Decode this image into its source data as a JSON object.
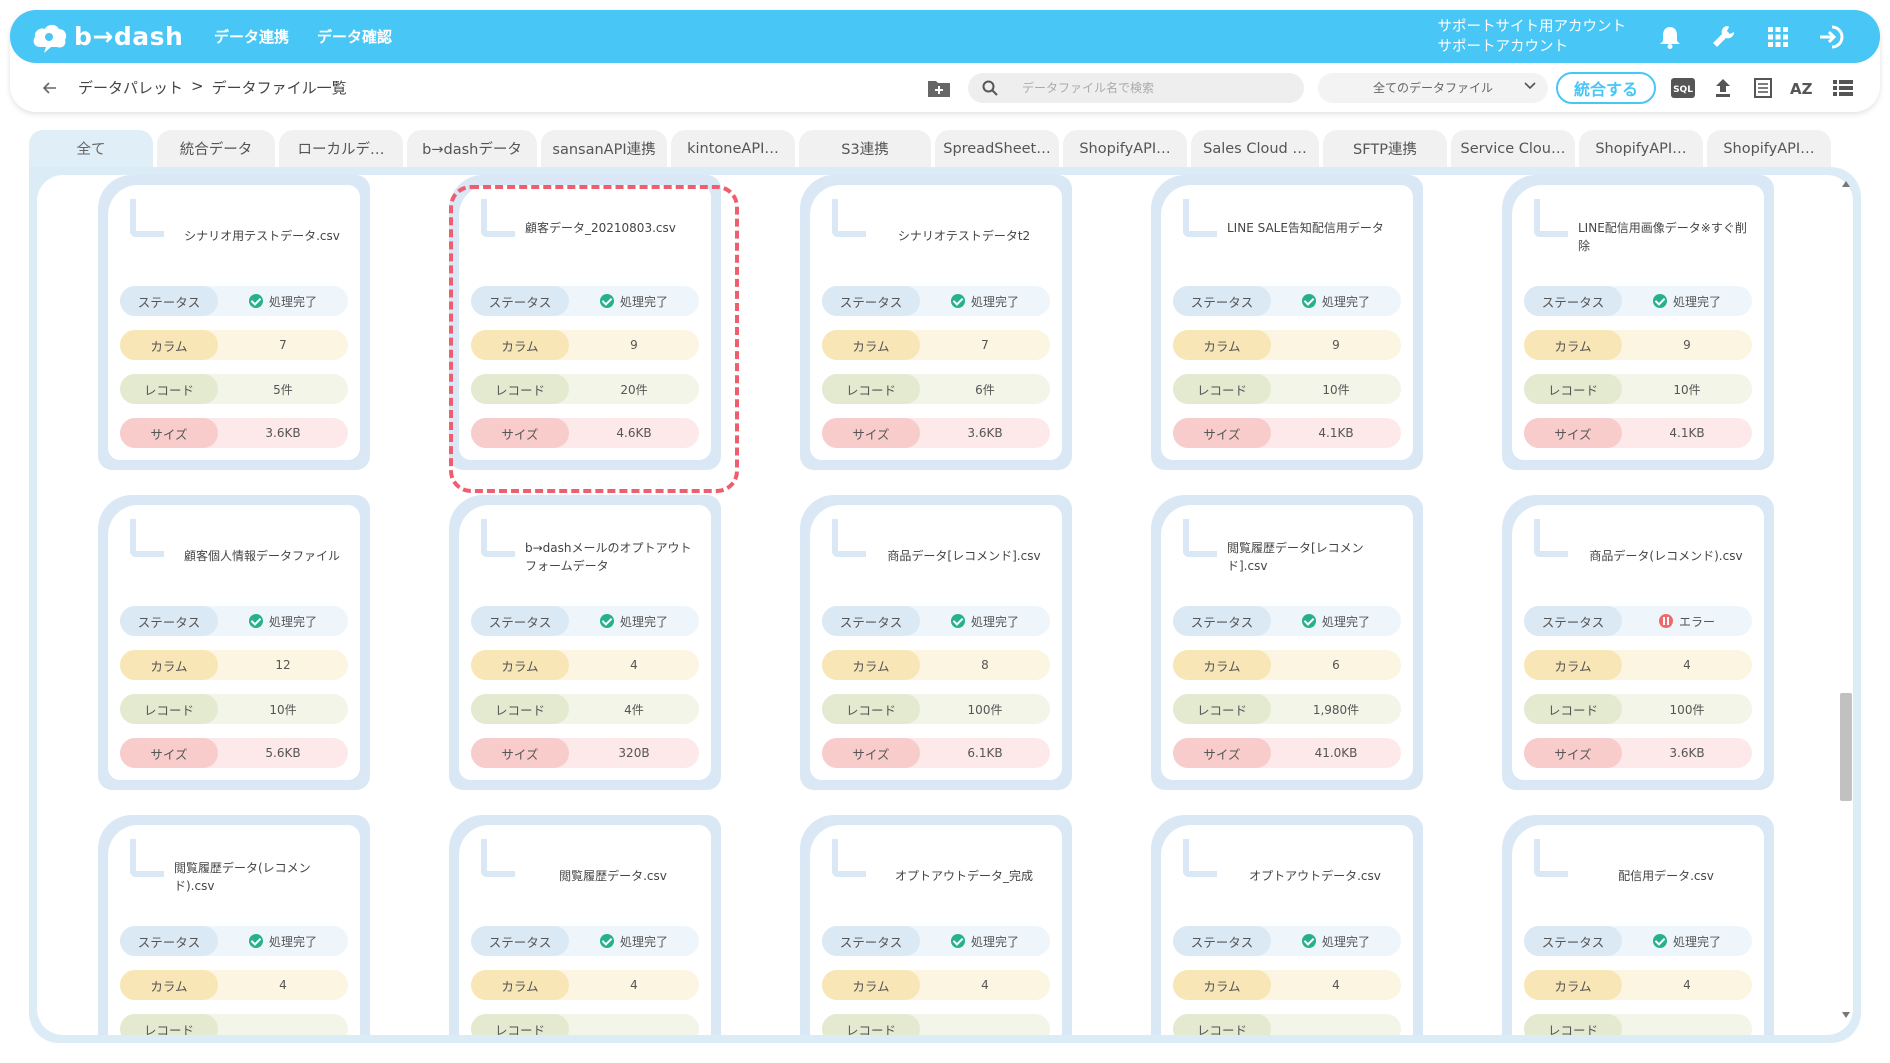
{
  "header": {
    "logo_text": "b→dash",
    "nav": [
      "データ連携",
      "データ確認"
    ],
    "account_line1": "サポートサイト用アカウント",
    "account_line2": "サポートアカウント",
    "icons": [
      "bell-icon",
      "wrench-icon",
      "grid-icon",
      "logout-icon"
    ]
  },
  "toolbar": {
    "breadcrumb": [
      "データパレット",
      ">",
      "データファイル一覧"
    ],
    "search_placeholder": "データファイル名で検索",
    "file_filter": "全てのデータファイル",
    "merge_label": "統合する",
    "sql_label": "SQL",
    "az_label": "AZ"
  },
  "tabs": [
    {
      "label": "全て",
      "w": 124
    },
    {
      "label": "統合データ",
      "w": 118
    },
    {
      "label": "ローカルデ…",
      "w": 124
    },
    {
      "label": "b→dashデータ",
      "w": 130
    },
    {
      "label": "sansanAPI連携",
      "w": 126
    },
    {
      "label": "kintoneAPI…",
      "w": 124
    },
    {
      "label": "S3連携",
      "w": 132
    },
    {
      "label": "SpreadSheet…",
      "w": 124
    },
    {
      "label": "ShopifyAPI…",
      "w": 124
    },
    {
      "label": "Sales Cloud …",
      "w": 128
    },
    {
      "label": "SFTP連携",
      "w": 124
    },
    {
      "label": "Service Clou…",
      "w": 124
    },
    {
      "label": "ShopifyAPI…",
      "w": 124
    },
    {
      "label": "ShopifyAPI…",
      "w": 124
    }
  ],
  "labels": {
    "status": "ステータス",
    "column": "カラム",
    "record": "レコード",
    "size": "サイズ"
  },
  "cards": [
    {
      "title": "シナリオ用テストデータ.csv",
      "status": "処理完了",
      "status_type": "ok",
      "columns": "7",
      "records": "5件",
      "size": "3.6KB"
    },
    {
      "title": "顧客データ_20210803.csv",
      "status": "処理完了",
      "status_type": "ok",
      "columns": "9",
      "records": "20件",
      "size": "4.6KB"
    },
    {
      "title": "シナリオテストデータt2",
      "status": "処理完了",
      "status_type": "ok",
      "columns": "7",
      "records": "6件",
      "size": "3.6KB"
    },
    {
      "title": "LINE SALE告知配信用データ",
      "status": "処理完了",
      "status_type": "ok",
      "columns": "9",
      "records": "10件",
      "size": "4.1KB"
    },
    {
      "title": "LINE配信用画像データ※すぐ削除",
      "status": "処理完了",
      "status_type": "ok",
      "columns": "9",
      "records": "10件",
      "size": "4.1KB"
    },
    {
      "title": "顧客個人情報データファイル",
      "status": "処理完了",
      "status_type": "ok",
      "columns": "12",
      "records": "10件",
      "size": "5.6KB"
    },
    {
      "title": "b→dashメールのオプトアウトフォームデータ",
      "status": "処理完了",
      "status_type": "ok",
      "columns": "4",
      "records": "4件",
      "size": "320B"
    },
    {
      "title": "商品データ[レコメンド].csv",
      "status": "処理完了",
      "status_type": "ok",
      "columns": "8",
      "records": "100件",
      "size": "6.1KB"
    },
    {
      "title": "閲覧履歴データ[レコメンド].csv",
      "status": "処理完了",
      "status_type": "ok",
      "columns": "6",
      "records": "1,980件",
      "size": "41.0KB"
    },
    {
      "title": "商品データ(レコメンド).csv",
      "status": "エラー",
      "status_type": "err",
      "columns": "4",
      "records": "100件",
      "size": "3.6KB"
    },
    {
      "title": "閲覧履歴データ(レコメンド).csv",
      "status": "処理完了",
      "status_type": "ok",
      "columns": "4",
      "records": "",
      "size": ""
    },
    {
      "title": "閲覧履歴データ.csv",
      "status": "処理完了",
      "status_type": "ok",
      "columns": "4",
      "records": "",
      "size": ""
    },
    {
      "title": "オプトアウトデータ_完成",
      "status": "処理完了",
      "status_type": "ok",
      "columns": "4",
      "records": "",
      "size": ""
    },
    {
      "title": "オプトアウトデータ.csv",
      "status": "処理完了",
      "status_type": "ok",
      "columns": "4",
      "records": "",
      "size": ""
    },
    {
      "title": "配信用データ.csv",
      "status": "処理完了",
      "status_type": "ok",
      "columns": "4",
      "records": "",
      "size": ""
    }
  ]
}
